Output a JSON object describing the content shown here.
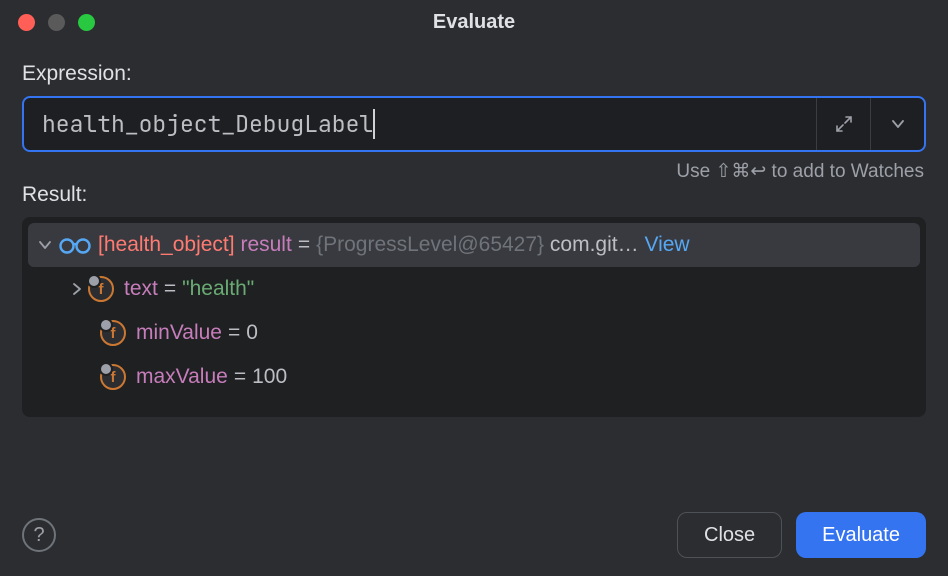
{
  "window": {
    "title": "Evaluate"
  },
  "labels": {
    "expression": "Expression:",
    "result": "Result:",
    "hint": "Use ⇧⌘↩ to add to Watches"
  },
  "expression": {
    "value": "health_object_DebugLabel"
  },
  "result": {
    "root": {
      "label_prefix": "[health_object]",
      "var_name": "result",
      "class_ref": "{ProgressLevel@65427}",
      "pkg": "com.git…",
      "view_link": "View"
    },
    "fields": [
      {
        "name": "text",
        "value": "\"health\"",
        "value_kind": "string",
        "expandable": true
      },
      {
        "name": "minValue",
        "value": "0",
        "value_kind": "number",
        "expandable": false
      },
      {
        "name": "maxValue",
        "value": "100",
        "value_kind": "number",
        "expandable": false
      }
    ]
  },
  "buttons": {
    "close": "Close",
    "evaluate": "Evaluate"
  }
}
